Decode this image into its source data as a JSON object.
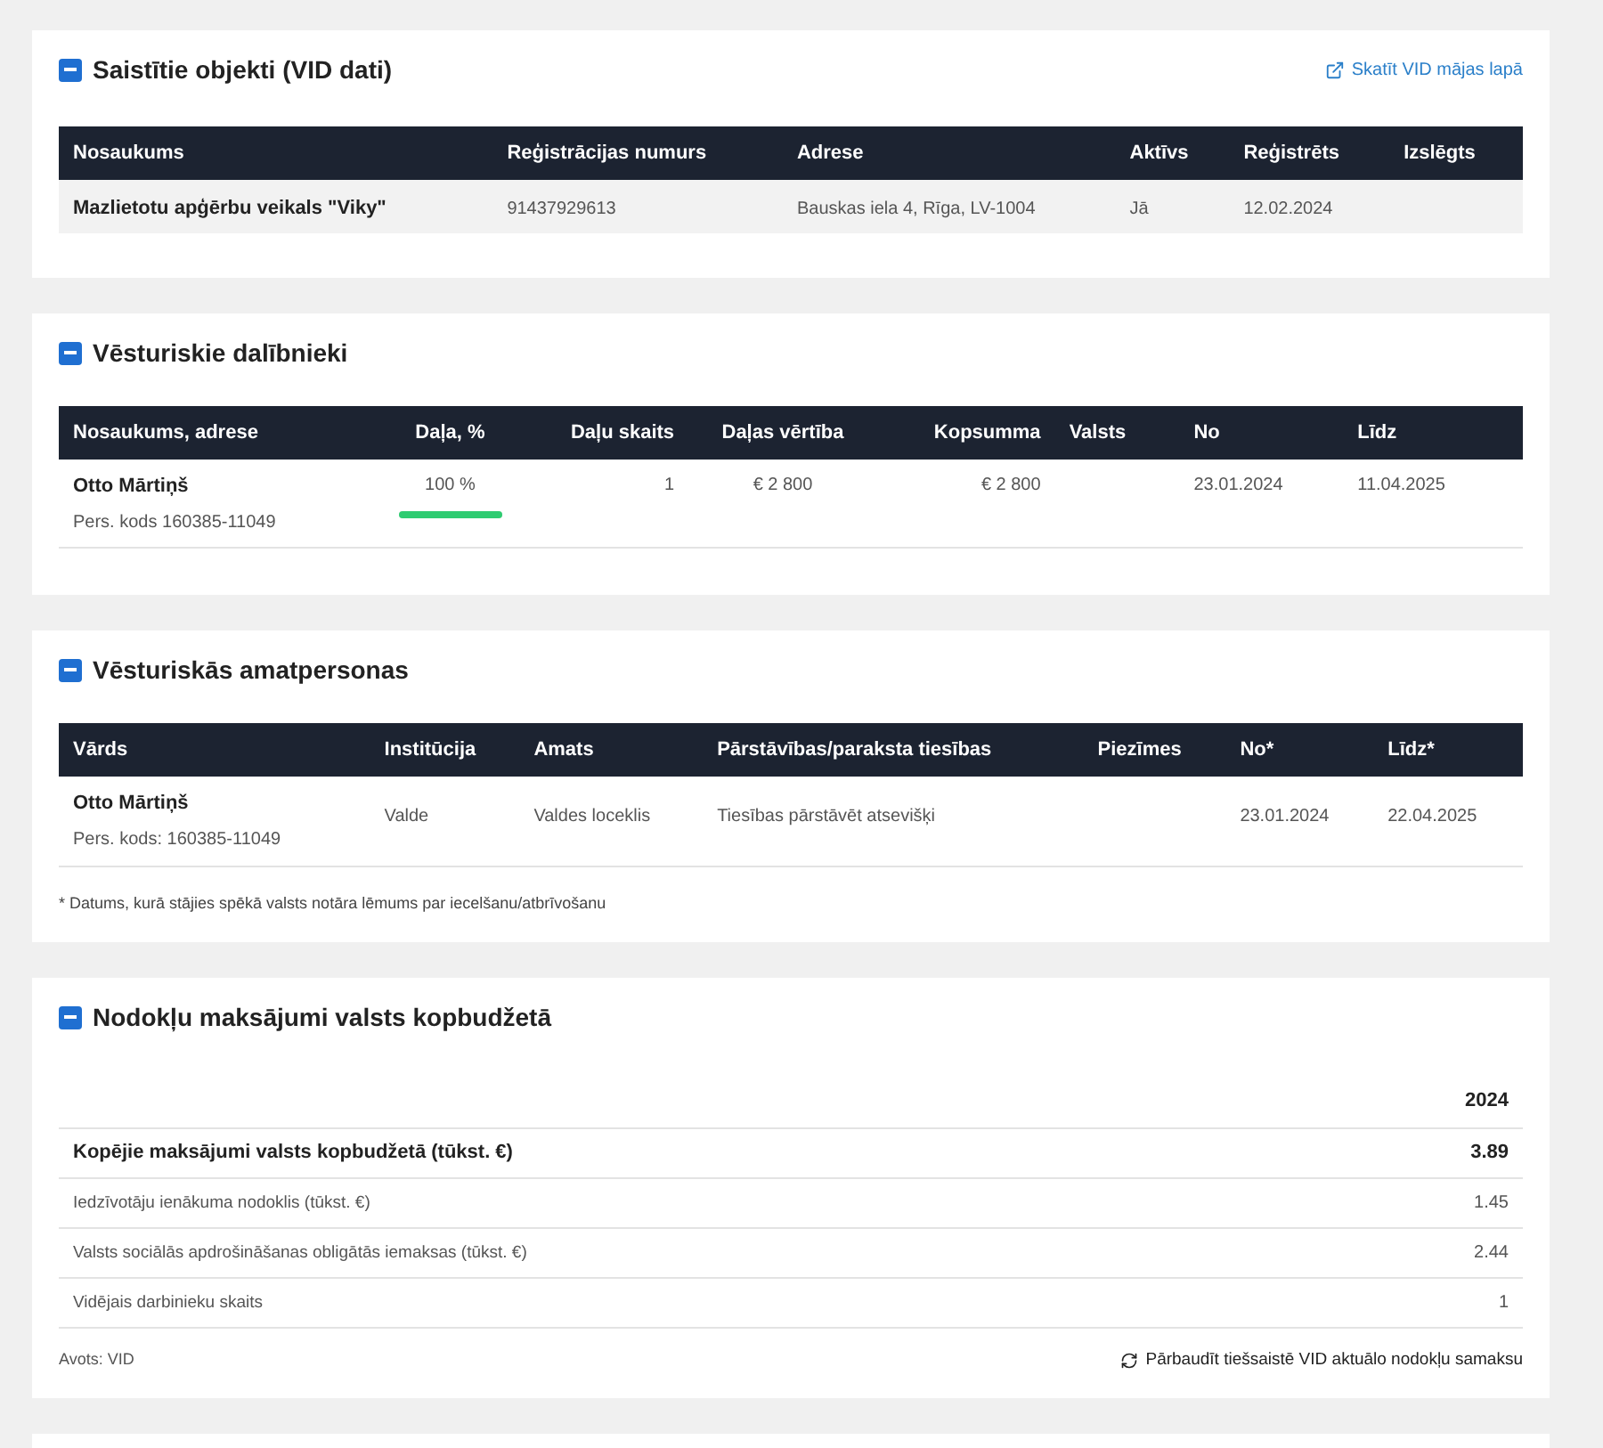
{
  "sections": [
    {
      "kind": "objects",
      "title": "Saistītie objekti (VID dati)",
      "expanded": true,
      "link": "Skatīt VID mājas lapā",
      "columns": [
        "Nosaukums",
        "Reģistrācijas numurs",
        "Adrese",
        "Aktīvs",
        "Reģistrēts",
        "Izslēgts"
      ],
      "rows": [
        {
          "cells": [
            "Mazlietotu apģērbu veikals \"Viky\"",
            "91437929613",
            "Bauskas iela 4, Rīga, LV-1004",
            "Jā",
            "12.02.2024",
            ""
          ]
        }
      ]
    },
    {
      "kind": "members",
      "title": "Vēsturiskie dalībnieki",
      "expanded": true,
      "columns": [
        "Nosaukums, adrese",
        "Daļa, %",
        "Daļu skaits",
        "Daļas vērtība",
        "Kopsumma",
        "Valsts",
        "No",
        "Līdz"
      ],
      "rows": [
        {
          "cells": [
            "Otto Mārtiņš",
            "100 %",
            "1",
            "€ 2 800",
            "€ 2 800",
            "",
            "23.01.2024",
            "11.04.2025"
          ],
          "sub": "Pers. kods 160385-11049",
          "level": 1
        }
      ]
    },
    {
      "kind": "officers",
      "title": "Vēsturiskās amatpersonas",
      "expanded": true,
      "columns": [
        "Vārds",
        "Institūcija",
        "Amats",
        "Pārstāvības/paraksta tiesības",
        "Piezīmes",
        "No*",
        "Līdz*"
      ],
      "rows": [
        {
          "cells": [
            "Otto Mārtiņš",
            "Valde",
            "Valdes loceklis",
            "Tiesības pārstāvēt atsevišķi",
            "",
            "23.01.2024",
            "22.04.2025"
          ],
          "sub": "Pers. kods: 160385-11049"
        }
      ],
      "footnote": "* Datums, kurā stājies spēkā valsts notāra lēmums par iecelšanu/atbrīvošanu"
    },
    {
      "kind": "taxes",
      "title": "Nodokļu maksājumi valsts kopbudžetā",
      "expanded": true,
      "year": "2024",
      "rows": [
        {
          "label": "Kopējie maksājumi valsts kopbudžetā (tūkst. €)",
          "value": "3.89",
          "total": true
        },
        {
          "label": "Iedzīvotāju ienākuma nodoklis (tūkst. €)",
          "value": "1.45",
          "total": false
        },
        {
          "label": "Valsts sociālās apdrošināšanas obligātās iemaksas (tūkst. €)",
          "value": "2.44",
          "total": false
        },
        {
          "label": "Vidējais darbinieku skaits",
          "value": "1",
          "total": false
        }
      ],
      "source": "Avots: VID",
      "check_link": "Pārbaudīt tiešsaistē VID aktuālo nodokļu samaksu"
    }
  ]
}
